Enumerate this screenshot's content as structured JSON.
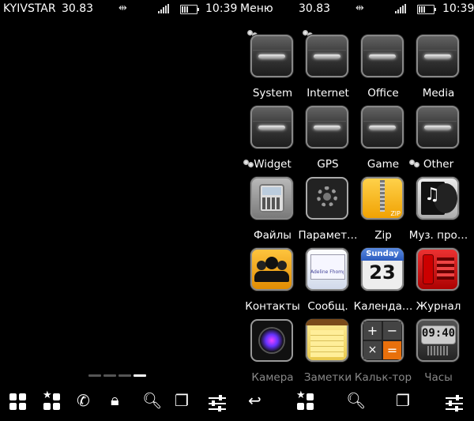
{
  "left": {
    "status": {
      "operator": "KYIVSTAR",
      "battery_value": "30.83",
      "time": "10:39"
    }
  },
  "right": {
    "status": {
      "title": "Меню",
      "battery_value": "30.83",
      "time": "10:39"
    },
    "items": [
      {
        "label": "System",
        "icon": "folder-icon"
      },
      {
        "label": "Internet",
        "icon": "folder-icon"
      },
      {
        "label": "Office",
        "icon": "folder-icon"
      },
      {
        "label": "Media",
        "icon": "folder-icon"
      },
      {
        "label": "Widget",
        "icon": "folder-icon"
      },
      {
        "label": "GPS",
        "icon": "folder-icon"
      },
      {
        "label": "Game",
        "icon": "folder-icon"
      },
      {
        "label": "Other",
        "icon": "folder-icon"
      },
      {
        "label": "Файлы",
        "icon": "file-manager-icon"
      },
      {
        "label": "Парамет…",
        "icon": "settings-gears-icon"
      },
      {
        "label": "Zip",
        "icon": "zip-icon"
      },
      {
        "label": "Муз. про…",
        "icon": "music-player-icon"
      },
      {
        "label": "Контакты",
        "icon": "contacts-icon"
      },
      {
        "label": "Сообщ.",
        "icon": "messages-icon"
      },
      {
        "label": "Календа…",
        "icon": "calendar-icon"
      },
      {
        "label": "Журнал",
        "icon": "call-log-icon"
      },
      {
        "label": "Камера",
        "icon": "camera-icon"
      },
      {
        "label": "Заметки",
        "icon": "notes-icon"
      },
      {
        "label": "Кальк-тор",
        "icon": "calculator-icon"
      },
      {
        "label": "Часы",
        "icon": "clock-icon"
      }
    ],
    "calendar_tile": {
      "day_name": "Sunday",
      "day_number": "23"
    },
    "clock_tile": {
      "time": "09:40"
    },
    "msg_tile": {
      "text": "Adeline Fhomps"
    },
    "zip_tile": {
      "text": "ZIP"
    }
  },
  "pager": {
    "pages": 4,
    "active_index": 3
  },
  "toolbar_left": [
    "apps-grid-icon",
    "favorites-icon",
    "phone-icon",
    "lock-icon",
    "search-icon",
    "copy-icon",
    "settings-sliders-icon"
  ],
  "toolbar_right": [
    "back-icon",
    "favorites-icon",
    "search-icon",
    "copy-icon",
    "settings-sliders-icon"
  ],
  "colors": {
    "background": "#000000",
    "text": "#ffffff"
  }
}
